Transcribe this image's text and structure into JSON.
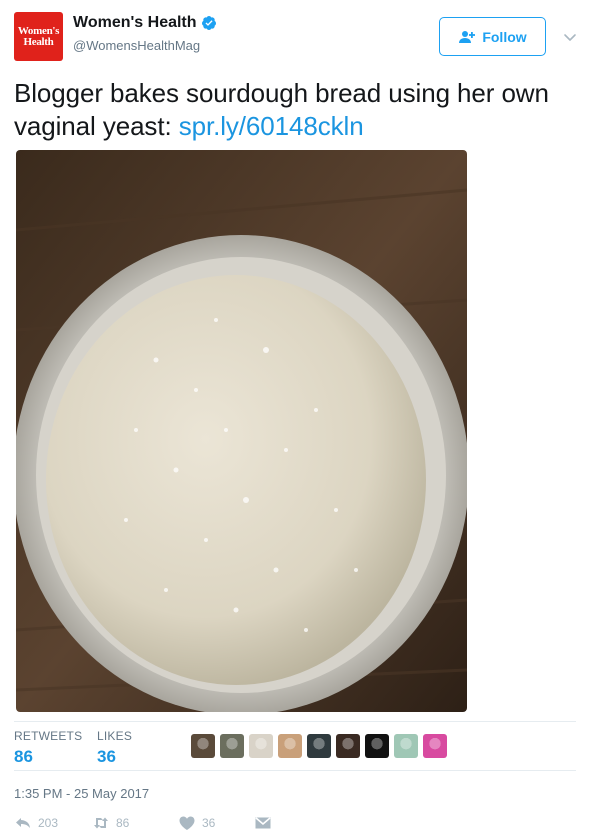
{
  "account": {
    "avatar_text_line1": "Women's",
    "avatar_text_line2": "Health",
    "display_name": "Women's Health",
    "handle": "@WomensHealthMag",
    "verified": true
  },
  "follow_button": {
    "label": "Follow",
    "icon": "add-user-icon"
  },
  "tweet": {
    "text": "Blogger bakes sourdough bread using her own vaginal yeast: ",
    "link_text": "spr.ly/60148ckln"
  },
  "stats": {
    "retweets_label": "RETWEETS",
    "retweets_value": "86",
    "likes_label": "LIKES",
    "likes_value": "36"
  },
  "liker_avatars": [
    {
      "color": "#5a4a3a"
    },
    {
      "color": "#6b6e5e"
    },
    {
      "color": "#d9d3c8"
    },
    {
      "color": "#c9a07a"
    },
    {
      "color": "#2f3a3e"
    },
    {
      "color": "#3a2a22"
    },
    {
      "color": "#111111"
    },
    {
      "color": "#9fc7b5"
    },
    {
      "color": "#d84aa0"
    }
  ],
  "timestamp": "1:35 PM - 25 May 2017",
  "actions": {
    "reply_count": "203",
    "retweet_count": "86",
    "like_count": "36"
  },
  "colors": {
    "brand_red": "#e0221b",
    "twitter_blue": "#1da1f2",
    "link_blue": "#1b95e0",
    "muted": "#657786",
    "action_gray": "#aab8c2"
  }
}
